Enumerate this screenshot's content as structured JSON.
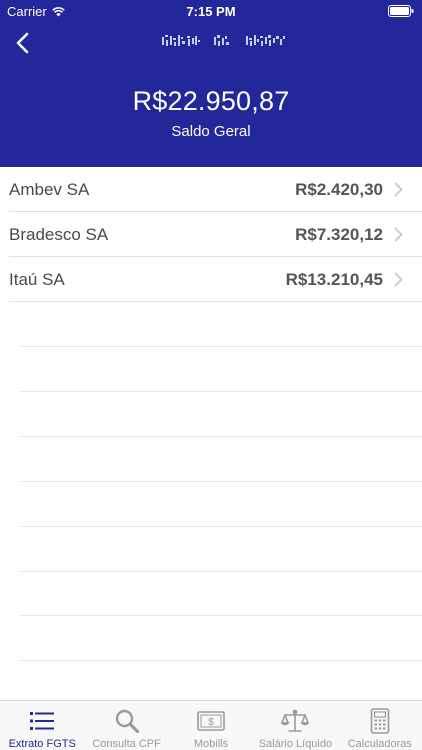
{
  "status_bar": {
    "carrier": "Carrier",
    "time": "7:15 PM"
  },
  "header": {
    "balance": "R$22.950,87",
    "balance_label": "Saldo Geral",
    "background_color": "#22279a"
  },
  "accounts": [
    {
      "name": "Ambev SA",
      "value": "R$2.420,30"
    },
    {
      "name": "Bradesco SA",
      "value": "R$7.320,12"
    },
    {
      "name": "Itaú SA",
      "value": "R$13.210,45"
    }
  ],
  "tabs": [
    {
      "label": "Extrato FGTS",
      "icon": "list-icon",
      "active": true
    },
    {
      "label": "Consulta CPF",
      "icon": "search-icon",
      "active": false
    },
    {
      "label": "Mobills",
      "icon": "money-note-icon",
      "active": false
    },
    {
      "label": "Salário Líquido",
      "icon": "scale-icon",
      "active": false
    },
    {
      "label": "Calculadoras",
      "icon": "calculator-icon",
      "active": false
    }
  ],
  "colors": {
    "accent": "#22279a",
    "inactive": "#9a9a9a"
  }
}
